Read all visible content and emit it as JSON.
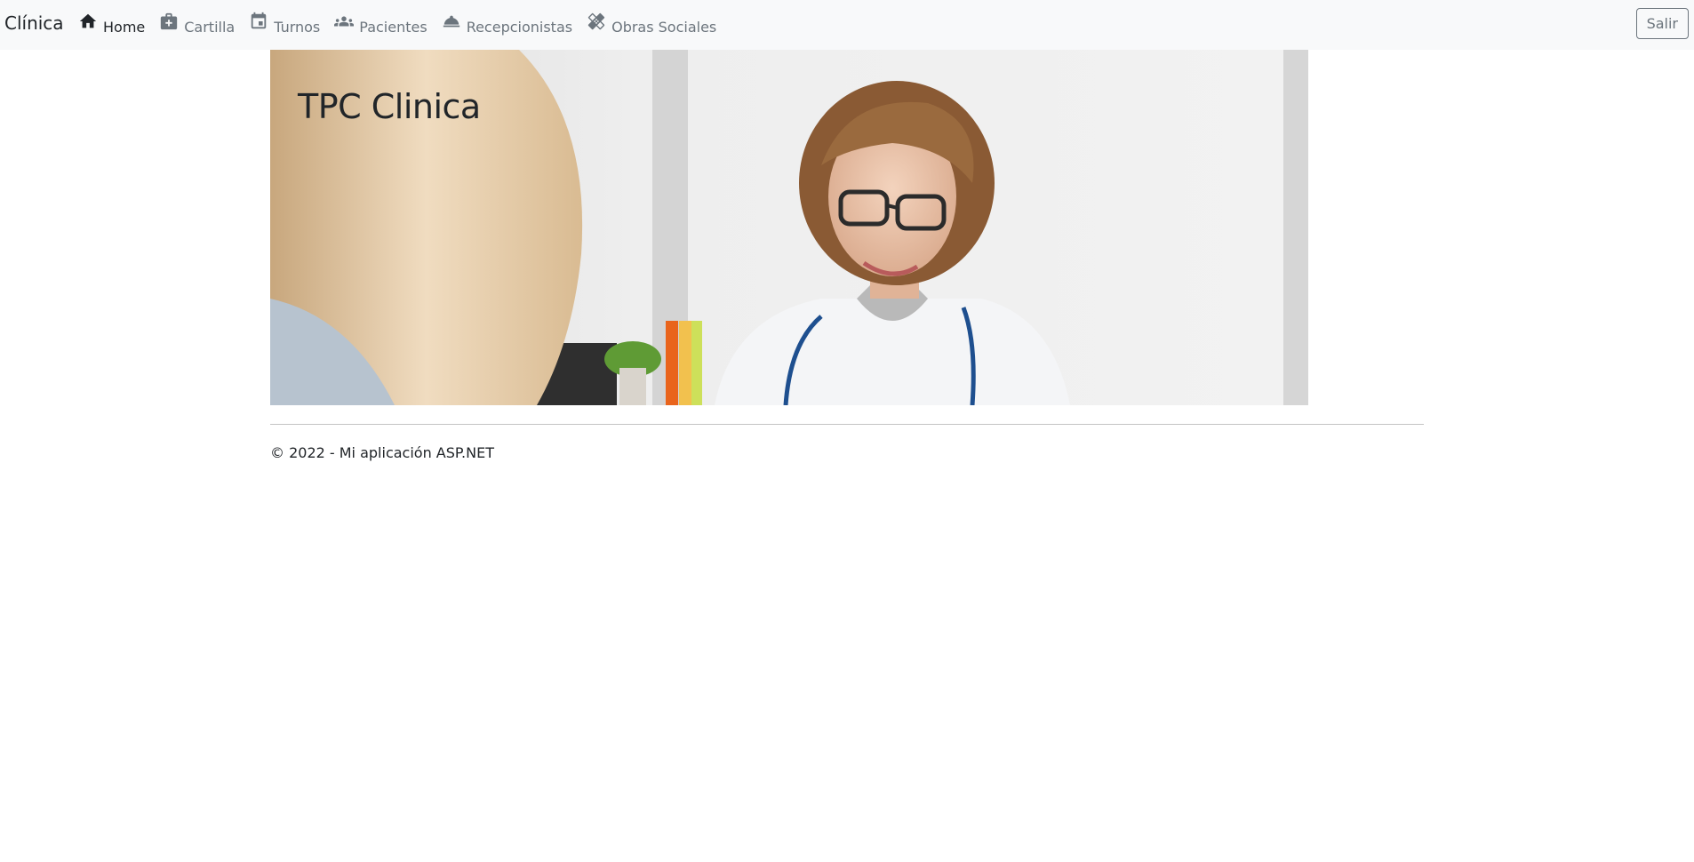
{
  "navbar": {
    "brand": "Clínica",
    "items": [
      {
        "label": "Home",
        "icon": "home-icon",
        "active": true
      },
      {
        "label": "Cartilla",
        "icon": "medical-bag-icon",
        "active": false
      },
      {
        "label": "Turnos",
        "icon": "calendar-icon",
        "active": false
      },
      {
        "label": "Pacientes",
        "icon": "people-icon",
        "active": false
      },
      {
        "label": "Recepcionistas",
        "icon": "service-bell-icon",
        "active": false
      },
      {
        "label": "Obras Sociales",
        "icon": "bandage-icon",
        "active": false
      }
    ],
    "logout_label": "Salir"
  },
  "hero": {
    "title": "TPC Clinica"
  },
  "footer": {
    "text": "© 2022 - Mi aplicación ASP.NET"
  },
  "colors": {
    "navbar_bg": "#f8f9fa",
    "nav_link": "#6c757d",
    "nav_active": "#212529"
  }
}
